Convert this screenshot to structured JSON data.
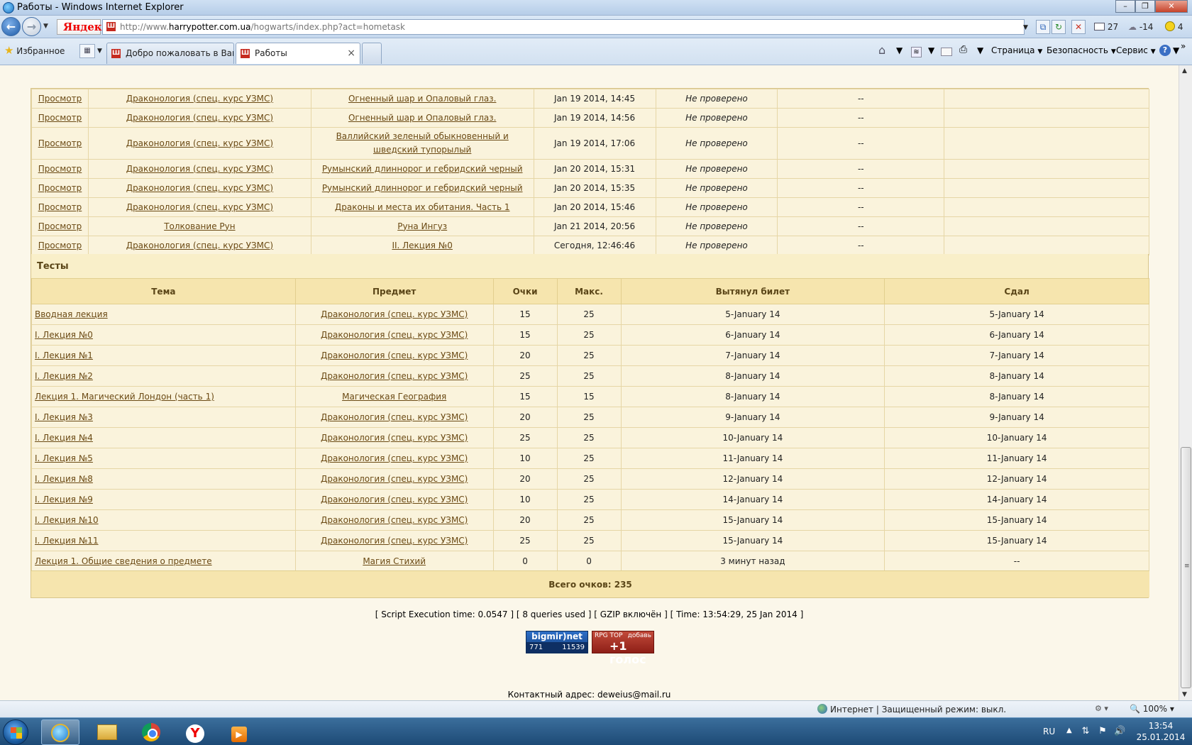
{
  "window": {
    "title": "Работы - Windows Internet Explorer"
  },
  "addressbar": {
    "yandex_brand": "Яндекс",
    "url_prefix": "http://www.",
    "url_domain": "harrypotter.com.ua",
    "url_path": "/hogwarts/index.php?act=hometask",
    "mail_count": "27",
    "weather": "-14",
    "traffic": "4"
  },
  "tabs": {
    "favorites_label": "Избранное",
    "items": [
      {
        "label": "Добро пожаловать в Ваш..."
      },
      {
        "label": "Работы"
      }
    ]
  },
  "commandbar": {
    "page": "Страница",
    "safety": "Безопасность",
    "tools": "Сервис"
  },
  "works": {
    "rows": [
      {
        "view": "Просмотр",
        "subject": "Драконология (спец. курс УЗМС)",
        "topic": "Огненный шар и Опаловый глаз.",
        "date": "Jan 19 2014, 14:45",
        "status": "Не проверено",
        "grade": "--"
      },
      {
        "view": "Просмотр",
        "subject": "Драконология (спец. курс УЗМС)",
        "topic": "Огненный шар и Опаловый глаз.",
        "date": "Jan 19 2014, 14:56",
        "status": "Не проверено",
        "grade": "--"
      },
      {
        "view": "Просмотр",
        "subject": "Драконология (спец. курс УЗМС)",
        "topic": "Валлийский зеленый обыкновенный и шведский тупорылый",
        "date": "Jan 19 2014, 17:06",
        "status": "Не проверено",
        "grade": "--"
      },
      {
        "view": "Просмотр",
        "subject": "Драконология (спец. курс УЗМС)",
        "topic": "Румынский длиннорог и гебридский черный",
        "date": "Jan 20 2014, 15:31",
        "status": "Не проверено",
        "grade": "--"
      },
      {
        "view": "Просмотр",
        "subject": "Драконология (спец. курс УЗМС)",
        "topic": "Румынский длиннорог и гебридский черный",
        "date": "Jan 20 2014, 15:35",
        "status": "Не проверено",
        "grade": "--"
      },
      {
        "view": "Просмотр",
        "subject": "Драконология (спец. курс УЗМС)",
        "topic": "Драконы и места их обитания. Часть 1",
        "date": "Jan 20 2014, 15:46",
        "status": "Не проверено",
        "grade": "--"
      },
      {
        "view": "Просмотр",
        "subject": "Толкование Рун",
        "topic": "Руна Ингуз",
        "date": "Jan 21 2014, 20:56",
        "status": "Не проверено",
        "grade": "--"
      },
      {
        "view": "Просмотр",
        "subject": "Драконология (спец. курс УЗМС)",
        "topic": "II. Лекция №0",
        "date": "Сегодня, 12:46:46",
        "status": "Не проверено",
        "grade": "--"
      }
    ]
  },
  "tests": {
    "title": "Тесты",
    "headers": [
      "Тема",
      "Предмет",
      "Очки",
      "Макс.",
      "Вытянул билет",
      "Сдал"
    ],
    "rows": [
      {
        "topic": "Вводная лекция",
        "subject": "Драконология (спец. курс УЗМС)",
        "points": "15",
        "max": "25",
        "drawn": "5-January 14",
        "passed": "5-January 14"
      },
      {
        "topic": "I. Лекция №0",
        "subject": "Драконология (спец. курс УЗМС)",
        "points": "15",
        "max": "25",
        "drawn": "6-January 14",
        "passed": "6-January 14"
      },
      {
        "topic": "I. Лекция №1",
        "subject": "Драконология (спец. курс УЗМС)",
        "points": "20",
        "max": "25",
        "drawn": "7-January 14",
        "passed": "7-January 14"
      },
      {
        "topic": "I. Лекция №2",
        "subject": "Драконология (спец. курс УЗМС)",
        "points": "25",
        "max": "25",
        "drawn": "8-January 14",
        "passed": "8-January 14"
      },
      {
        "topic": "Лекция 1. Магический Лондон (часть 1)",
        "subject": "Магическая География",
        "points": "15",
        "max": "15",
        "drawn": "8-January 14",
        "passed": "8-January 14"
      },
      {
        "topic": "I. Лекция №3",
        "subject": "Драконология (спец. курс УЗМС)",
        "points": "20",
        "max": "25",
        "drawn": "9-January 14",
        "passed": "9-January 14"
      },
      {
        "topic": "I. Лекция №4",
        "subject": "Драконология (спец. курс УЗМС)",
        "points": "25",
        "max": "25",
        "drawn": "10-January 14",
        "passed": "10-January 14"
      },
      {
        "topic": "I. Лекция №5",
        "subject": "Драконология (спец. курс УЗМС)",
        "points": "10",
        "max": "25",
        "drawn": "11-January 14",
        "passed": "11-January 14"
      },
      {
        "topic": "I. Лекция №8",
        "subject": "Драконология (спец. курс УЗМС)",
        "points": "20",
        "max": "25",
        "drawn": "12-January 14",
        "passed": "12-January 14"
      },
      {
        "topic": "I. Лекция №9",
        "subject": "Драконология (спец. курс УЗМС)",
        "points": "10",
        "max": "25",
        "drawn": "14-January 14",
        "passed": "14-January 14"
      },
      {
        "topic": "I. Лекция №10",
        "subject": "Драконология (спец. курс УЗМС)",
        "points": "20",
        "max": "25",
        "drawn": "15-January 14",
        "passed": "15-January 14"
      },
      {
        "topic": "I. Лекция №11",
        "subject": "Драконология (спец. курс УЗМС)",
        "points": "25",
        "max": "25",
        "drawn": "15-January 14",
        "passed": "15-January 14"
      },
      {
        "topic": "Лекция 1. Общие сведения о предмете",
        "subject": "Магия Стихий",
        "points": "0",
        "max": "0",
        "drawn": "3 минут назад",
        "passed": "--"
      }
    ],
    "total": "Всего очков: 235"
  },
  "footer": {
    "stats": "[ Script Execution time: 0.0547 ]   [ 8 queries used ]   [ GZIP включён ]   [ Time: 13:54:29, 25 Jan 2014 ]",
    "bigmir_brand": "bigmir)net",
    "bigmir_left": "771",
    "bigmir_right": "11539",
    "rpg_top": "RPG TOP",
    "rpg_plus": "+1 голос",
    "rpg_add": "добавь",
    "contact": "Контактный адрес: deweius@mail.ru"
  },
  "statusbar": {
    "zone": "Интернет | Защищенный режим: выкл.",
    "zoom": "100%"
  },
  "taskbar": {
    "lang": "RU",
    "time": "13:54",
    "date": "25.01.2014"
  },
  "colors": {
    "page_bg": "#fbf7ea",
    "panel_bg": "#f9efc9",
    "header_bg": "#f6e5ae",
    "link": "#6b4a14"
  },
  "icons": [
    "ie-icon",
    "back-icon",
    "forward-icon",
    "compat-icon",
    "refresh-icon",
    "stop-icon",
    "mail-icon",
    "weather-icon",
    "traffic-icon",
    "star-icon",
    "home-icon",
    "feed-icon",
    "print-icon",
    "help-icon",
    "globe-icon",
    "start-icon"
  ]
}
